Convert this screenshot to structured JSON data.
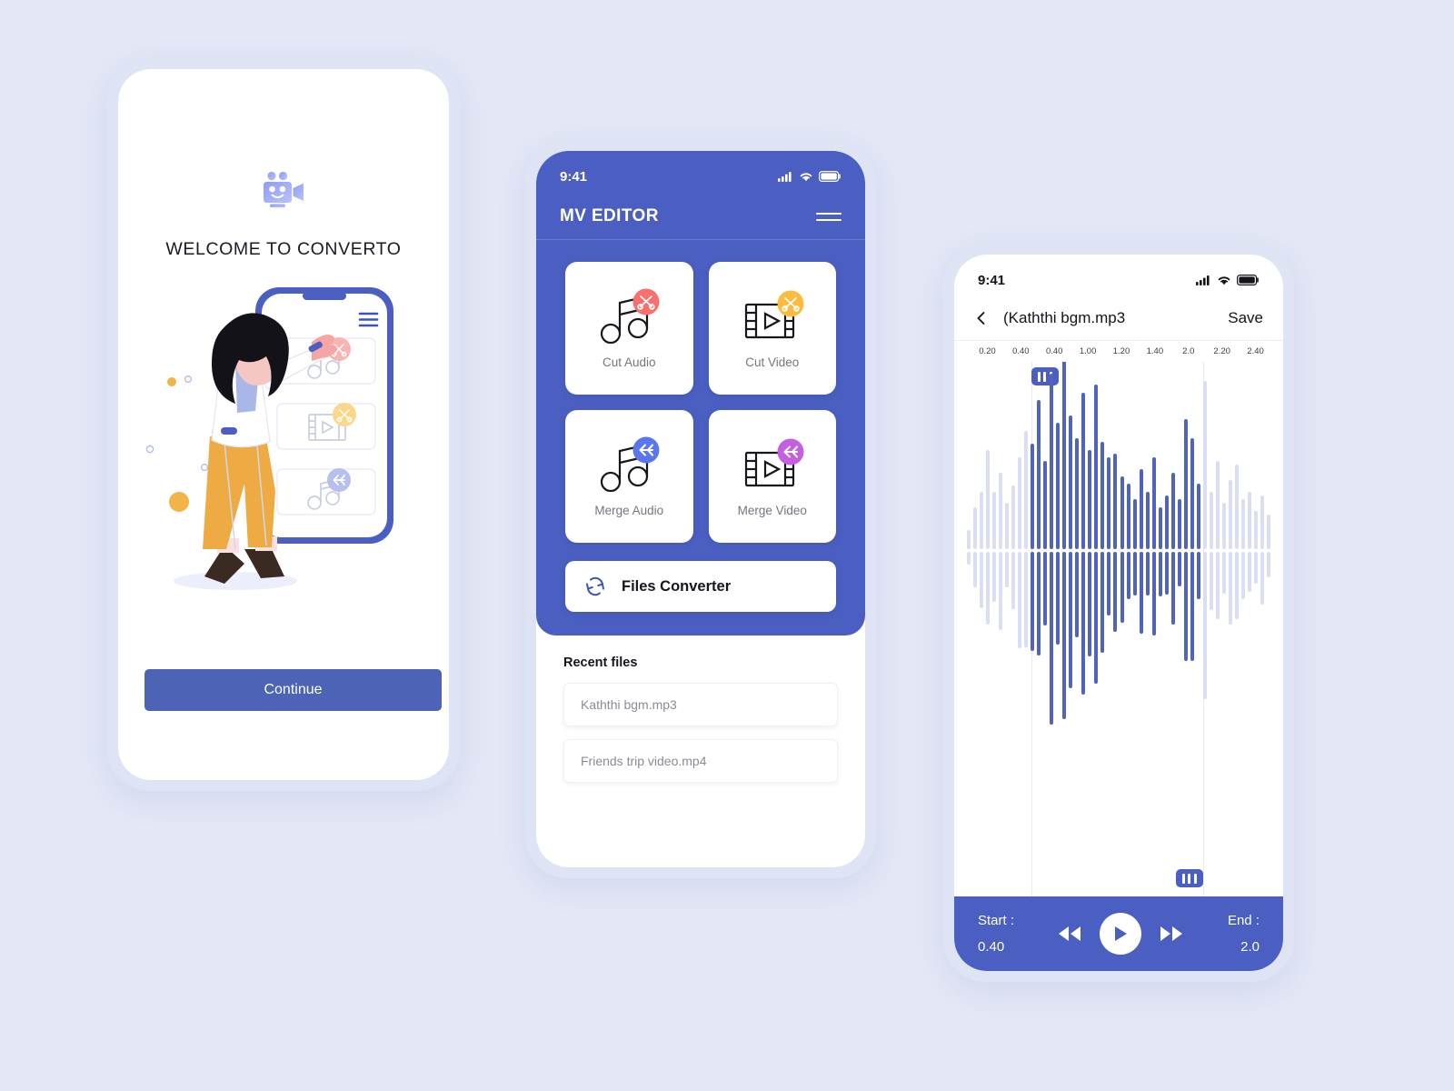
{
  "theme": {
    "page_background": "#e3e7f6",
    "primary": "#4a5fc1",
    "accent_red": "#f8706e",
    "accent_yellow": "#fbbb3f",
    "accent_blue": "#5a76ef",
    "accent_purple": "#c45fe0",
    "wave_active": "#5064bd",
    "wave_inactive": "#dadef4"
  },
  "welcome": {
    "logo_icon": "movie-camera-icon",
    "title": "WELCOME TO CONVERTO",
    "continue_label": "Continue",
    "illustration": {
      "name": "woman-pointing-at-phone-illustration",
      "phone_menu_icon": "hamburger-icon",
      "cards": [
        {
          "icon": "music-note-icon",
          "badge": "scissors-icon",
          "badge_color": "#f9b3b1"
        },
        {
          "icon": "film-strip-icon",
          "badge": "scissors-icon",
          "badge_color": "#fbd78a"
        },
        {
          "icon": "music-note-icon",
          "badge": "merge-arrow-icon",
          "badge_color": "#b6bff0"
        }
      ]
    }
  },
  "editor": {
    "status_bar": {
      "time": "9:41",
      "icons": [
        "signal-icon",
        "wifi-icon",
        "battery-icon"
      ]
    },
    "app_title": "MV EDITOR",
    "menu_icon": "hamburger-icon",
    "tools": [
      {
        "label": "Cut Audio",
        "icon": "music-note-icon",
        "badge": "scissors-icon",
        "badge_color": "#f8706e"
      },
      {
        "label": "Cut Video",
        "icon": "film-strip-icon",
        "badge": "scissors-icon",
        "badge_color": "#fbbb3f"
      },
      {
        "label": "Merge Audio",
        "icon": "music-note-icon",
        "badge": "merge-arrow-icon",
        "badge_color": "#5a76ef"
      },
      {
        "label": "Merge Video",
        "icon": "film-strip-icon",
        "badge": "merge-arrow-icon",
        "badge_color": "#c45fe0"
      }
    ],
    "converter": {
      "label": "Files Converter",
      "icon": "refresh-icon"
    },
    "recent": {
      "title": "Recent files",
      "files": [
        "Kaththi bgm.mp3",
        "Friends trip video.mp4"
      ]
    }
  },
  "trimmer": {
    "status_bar": {
      "time": "9:41",
      "icons": [
        "signal-icon",
        "wifi-icon",
        "battery-icon"
      ]
    },
    "back_icon": "chevron-left-icon",
    "title": "(Kaththi bgm.mp3",
    "save_label": "Save",
    "ruler_ticks": [
      "0.20",
      "0.40",
      "0.40",
      "1.00",
      "1.20",
      "1.40",
      "2.0",
      "2.20",
      "2.40"
    ],
    "start_label": "Start :",
    "start_value": "0.40",
    "end_label": "End :",
    "end_value": "2.0",
    "controls": [
      {
        "name": "rewind-button",
        "icon": "rewind-icon"
      },
      {
        "name": "play-button",
        "icon": "play-icon"
      },
      {
        "name": "forward-button",
        "icon": "fast-forward-icon"
      }
    ],
    "selection": {
      "start_fraction": 0.215,
      "end_fraction": 0.775
    },
    "waveform": [
      0.1,
      0.22,
      0.3,
      0.52,
      0.3,
      0.4,
      0.24,
      0.33,
      0.48,
      0.62,
      0.55,
      0.78,
      0.46,
      0.92,
      0.66,
      1.0,
      0.7,
      0.58,
      0.82,
      0.52,
      0.86,
      0.56,
      0.48,
      0.5,
      0.38,
      0.34,
      0.26,
      0.42,
      0.3,
      0.48,
      0.22,
      0.28,
      0.4,
      0.26,
      0.68,
      0.58,
      0.34,
      0.88,
      0.3,
      0.46,
      0.24,
      0.36,
      0.44,
      0.26,
      0.3,
      0.2,
      0.28,
      0.18
    ]
  }
}
